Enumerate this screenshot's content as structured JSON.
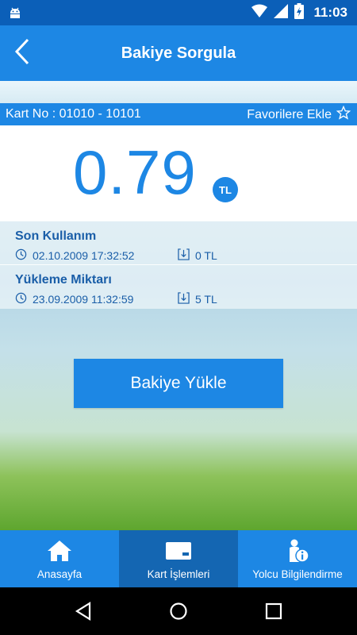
{
  "status_bar": {
    "time": "11:03",
    "icons": [
      "android-icon",
      "wifi-icon",
      "signal-icon",
      "battery-charging-icon"
    ]
  },
  "app_bar": {
    "title": "Bakiye Sorgula",
    "back_icon": "chevron-left-icon"
  },
  "card_bar": {
    "card_number": "Kart No : 01010 - 10101",
    "favorite_label": "Favorilere Ekle",
    "favorite_icon": "star-outline-icon"
  },
  "balance": {
    "amount": "0.79",
    "currency": "TL"
  },
  "last_usage": {
    "label": "Son Kullanım",
    "datetime": "02.10.2009 17:32:52",
    "amount": "0 TL"
  },
  "last_load": {
    "label": "Yükleme Miktarı",
    "datetime": "23.09.2009 11:32:59",
    "amount": "5 TL"
  },
  "load_button": {
    "label": "Bakiye Yükle"
  },
  "bottom_nav": {
    "items": [
      {
        "label": "Anasayfa",
        "icon": "home-icon"
      },
      {
        "label": "Kart İşlemleri",
        "icon": "card-icon",
        "active": true
      },
      {
        "label": "Yolcu Bilgilendirme",
        "icon": "passenger-info-icon"
      }
    ]
  },
  "colors": {
    "primary": "#1d87e4",
    "status_bar": "#0b5fb8",
    "active_tab": "#1466b2",
    "text_blue": "#1a5ea8"
  }
}
